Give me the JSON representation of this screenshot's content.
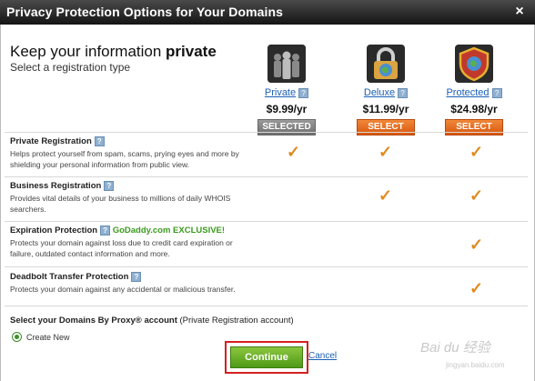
{
  "window": {
    "title": "Privacy Protection Options for Your Domains",
    "close": "×"
  },
  "heading": {
    "prefix": "Keep your information ",
    "bold": "private",
    "subtitle": "Select a registration type"
  },
  "plans": [
    {
      "name": "Private",
      "price": "$9.99/yr",
      "button": "SELECTED",
      "icon": "private-people-icon"
    },
    {
      "name": "Deluxe",
      "price": "$11.99/yr",
      "button": "SELECT",
      "icon": "padlock-globe-icon"
    },
    {
      "name": "Protected",
      "price": "$24.98/yr",
      "button": "SELECT",
      "icon": "shield-icon"
    }
  ],
  "features": [
    {
      "title": "Private Registration",
      "description": "Helps protect yourself from spam, scams, prying eyes and more by shielding your personal information from public view.",
      "included": [
        true,
        true,
        true
      ]
    },
    {
      "title": "Business Registration",
      "description": "Provides vital details of your business to millions of daily WHOIS searchers.",
      "included": [
        false,
        true,
        true
      ]
    },
    {
      "title": "Expiration Protection",
      "exclusive": "GoDaddy.com EXCLUSIVE!",
      "description": "Protects your domain against loss due to credit card expiration or failure, outdated contact information and more.",
      "included": [
        false,
        false,
        true
      ]
    },
    {
      "title": "Deadbolt Transfer Protection",
      "description": "Protects your domain against any accidental or malicious transfer.",
      "included": [
        false,
        false,
        true
      ]
    }
  ],
  "account": {
    "label_bold": "Select your Domains By Proxy® account",
    "label_rest": " (Private Registration account)",
    "option": "Create New"
  },
  "actions": {
    "continue": "Continue",
    "cancel": "Cancel"
  },
  "help_glyph": "?",
  "check_glyph": "✓",
  "watermark": {
    "main": "Bai du 经验",
    "sub": "jingyan.baidu.com"
  },
  "colors": {
    "title_bar": "#1e1e1e",
    "select_orange": "#e06a1a",
    "selected_gray": "#7c7c7c",
    "continue_green": "#5ca823",
    "check_orange": "#e08a1e",
    "link_blue": "#1a5fb4",
    "exclusive_green": "#3a9b1e"
  }
}
